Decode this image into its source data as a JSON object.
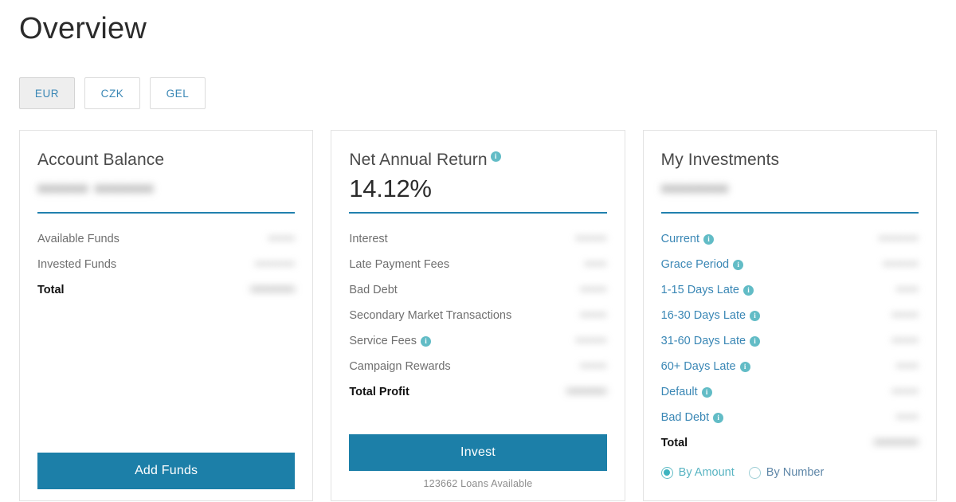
{
  "header": {
    "title": "Overview"
  },
  "currency": {
    "options": [
      {
        "label": "EUR",
        "active": true
      },
      {
        "label": "CZK",
        "active": false
      },
      {
        "label": "GEL",
        "active": false
      }
    ]
  },
  "cards": [
    {
      "title": "Account Balance",
      "headline": "•••••• •••••••",
      "headline_redacted": true,
      "rows": [
        {
          "label": "Available Funds",
          "value": "••••••",
          "redacted": true,
          "info": false,
          "link": false,
          "total": false
        },
        {
          "label": "Invested Funds",
          "value": "•••••••••",
          "redacted": true,
          "info": false,
          "link": false,
          "total": false
        },
        {
          "label": "Total",
          "value": "••••••••••",
          "redacted": true,
          "info": false,
          "link": false,
          "total": true
        }
      ],
      "cta": {
        "label": "Add Funds",
        "note": ""
      }
    },
    {
      "title": "Net Annual Return",
      "title_info": true,
      "headline": "14.12%",
      "headline_redacted": false,
      "rows": [
        {
          "label": "Interest",
          "value": "•••••••",
          "redacted": true,
          "info": false,
          "link": false,
          "total": false
        },
        {
          "label": "Late Payment Fees",
          "value": "•••••",
          "redacted": true,
          "info": false,
          "link": false,
          "total": false
        },
        {
          "label": "Bad Debt",
          "value": "••••••",
          "redacted": true,
          "info": false,
          "link": false,
          "total": false
        },
        {
          "label": "Secondary Market Transactions",
          "value": "••••••",
          "redacted": true,
          "info": false,
          "link": false,
          "total": false
        },
        {
          "label": "Service Fees",
          "value": "•••••••",
          "redacted": true,
          "info": true,
          "link": false,
          "total": false
        },
        {
          "label": "Campaign Rewards",
          "value": "••••••",
          "redacted": true,
          "info": false,
          "link": false,
          "total": false
        },
        {
          "label": "Total Profit",
          "value": "•••••••••",
          "redacted": true,
          "info": false,
          "link": false,
          "total": true
        }
      ],
      "cta": {
        "label": "Invest",
        "note": "123662 Loans Available"
      }
    },
    {
      "title": "My Investments",
      "headline": "••••••••",
      "headline_redacted": true,
      "rows": [
        {
          "label": "Current",
          "value": "•••••••••",
          "redacted": true,
          "info": true,
          "link": true,
          "total": false
        },
        {
          "label": "Grace Period",
          "value": "••••••••",
          "redacted": true,
          "info": true,
          "link": true,
          "total": false
        },
        {
          "label": "1-15 Days Late",
          "value": "•••••",
          "redacted": true,
          "info": true,
          "link": true,
          "total": false
        },
        {
          "label": "16-30 Days Late",
          "value": "••••••",
          "redacted": true,
          "info": true,
          "link": true,
          "total": false
        },
        {
          "label": "31-60 Days Late",
          "value": "••••••",
          "redacted": true,
          "info": true,
          "link": true,
          "total": false
        },
        {
          "label": "60+ Days Late",
          "value": "•••••",
          "redacted": true,
          "info": true,
          "link": true,
          "total": false
        },
        {
          "label": "Default",
          "value": "••••••",
          "redacted": true,
          "info": true,
          "link": true,
          "total": false
        },
        {
          "label": "Bad Debt",
          "value": "•••••",
          "redacted": true,
          "info": true,
          "link": true,
          "total": false
        },
        {
          "label": "Total",
          "value": "••••••••••",
          "redacted": true,
          "info": false,
          "link": false,
          "total": true
        }
      ],
      "radios": [
        {
          "label": "By Amount",
          "selected": true
        },
        {
          "label": "By Number",
          "selected": false
        }
      ]
    }
  ],
  "icons": {
    "info": "info-icon",
    "radio_selected": "radio-selected-icon",
    "radio_unselected": "radio-unselected-icon"
  },
  "colors": {
    "accent": "#2180ae",
    "button": "#1c7fa8",
    "link": "#3a87b5",
    "info": "#62bcc6",
    "radio": "#3eb4c0"
  }
}
